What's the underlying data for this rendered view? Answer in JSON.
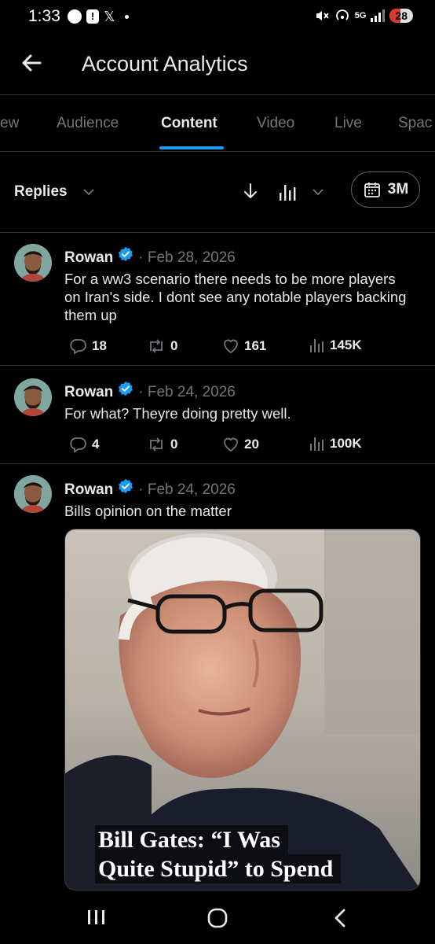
{
  "status_bar": {
    "time": "1:33",
    "x_glyph": "𝕏",
    "network": "5G",
    "battery": "28"
  },
  "header": {
    "title": "Account Analytics"
  },
  "tabs": [
    {
      "label": "ew"
    },
    {
      "label": "Audience"
    },
    {
      "label": "Content",
      "active": true
    },
    {
      "label": "Video"
    },
    {
      "label": "Live"
    },
    {
      "label": "Spac"
    }
  ],
  "filter": {
    "type_label": "Replies",
    "range_label": "3M"
  },
  "posts": [
    {
      "author": "Rowan",
      "date": "· Feb 28, 2026",
      "text": "For a ww3 scenario there needs to be more players on Iran's side. I dont see any notable players backing them up",
      "replies": "18",
      "reposts": "0",
      "likes": "161",
      "views": "145K"
    },
    {
      "author": "Rowan",
      "date": "· Feb 24, 2026",
      "text": "For what? Theyre doing pretty well.",
      "replies": "4",
      "reposts": "0",
      "likes": "20",
      "views": "100K"
    },
    {
      "author": "Rowan",
      "date": "· Feb 24, 2026",
      "text": "Bills opinion on the matter",
      "media_headline_1": "Bill Gates: “I Was",
      "media_headline_2": "Quite Stupid” to Spend"
    }
  ],
  "colors": {
    "accent": "#1d9bf0",
    "muted": "#71767b",
    "divider": "#2f3336",
    "background": "#000000"
  },
  "icons": [
    "back-arrow-icon",
    "chevron-down-icon",
    "sort-down-icon",
    "bar-chart-icon",
    "calendar-icon",
    "verified-badge-icon",
    "reply-icon",
    "repost-icon",
    "like-icon",
    "views-icon",
    "recents-icon",
    "home-icon",
    "back-icon"
  ]
}
